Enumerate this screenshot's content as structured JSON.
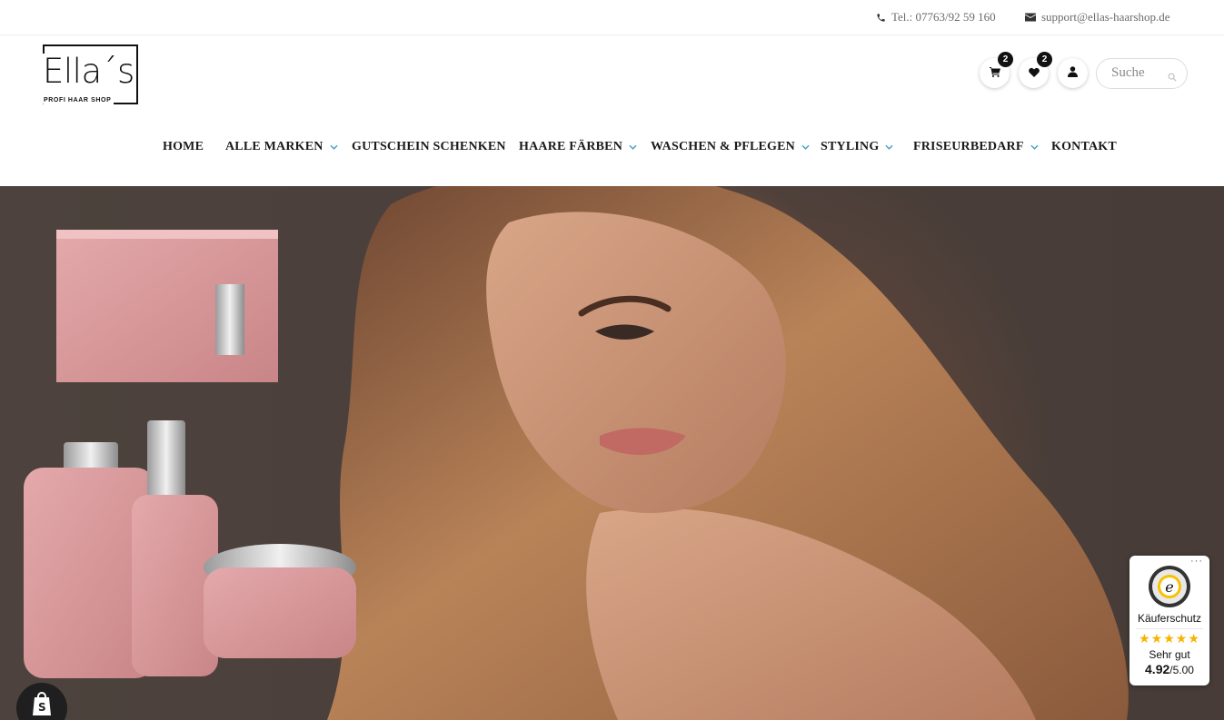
{
  "topbar": {
    "phone": "Tel.: 07763/92 59 160",
    "email": "support@ellas-haarshop.de",
    "phone_icon": "phone-icon",
    "email_icon": "envelope-icon"
  },
  "logo": {
    "name": "Ella´s",
    "tagline": "PROFI HAAR SHOP"
  },
  "header": {
    "cart_count": "2",
    "wishlist_count": "2",
    "search_placeholder": "Suche"
  },
  "nav": {
    "items": [
      {
        "label": "HOME",
        "has_dropdown": false
      },
      {
        "label": "ALLE MARKEN",
        "has_dropdown": true
      },
      {
        "label": "GUTSCHEIN SCHENKEN",
        "has_dropdown": false
      },
      {
        "label": "HAARE FÄRBEN",
        "has_dropdown": true
      },
      {
        "label": "WASCHEN & PFLEGEN",
        "has_dropdown": true
      },
      {
        "label": "STYLING",
        "has_dropdown": true
      },
      {
        "label": "FRISEURBEDARF",
        "has_dropdown": true
      },
      {
        "label": "KONTAKT",
        "has_dropdown": false
      }
    ]
  },
  "trust_badge": {
    "label": "Käuferschutz",
    "stars": "★★★★★",
    "verdict": "Sehr gut",
    "score": "4.92",
    "score_max": "/5.00",
    "more": "···"
  },
  "colors": {
    "accent": "#4aa3c8",
    "text": "#1a1a1a",
    "hero_bg": "#4a3f3a",
    "star": "#f5b400"
  }
}
